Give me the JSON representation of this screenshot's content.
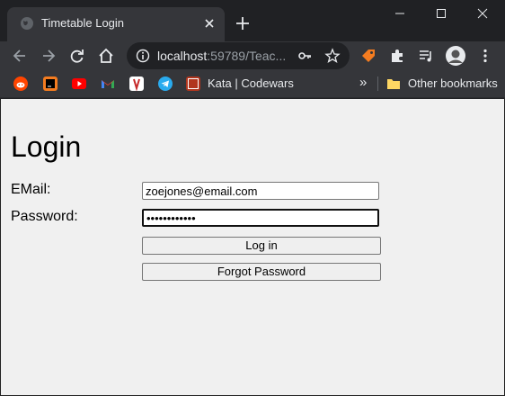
{
  "browser": {
    "tab": {
      "title": "Timetable Login"
    },
    "address": {
      "host": "localhost",
      "rest": ":59789/Teac..."
    },
    "bookmarks": [
      {
        "name": "reddit",
        "color": "#ff4500"
      },
      {
        "name": "jetbrains",
        "color": "#f47c20"
      },
      {
        "name": "youtube",
        "color": "#ff0000"
      },
      {
        "name": "gmail",
        "color": "#ea4335"
      },
      {
        "name": "bookmark-app",
        "color": "#e8eaed"
      },
      {
        "name": "telegram",
        "color": "#2aabee"
      }
    ],
    "codewars_label": "Kata | Codewars",
    "overflow": "»",
    "other_bookmarks": "Other bookmarks"
  },
  "page": {
    "title": "Login",
    "email": {
      "label": "EMail:",
      "value": "zoejones@email.com"
    },
    "password": {
      "label": "Password:",
      "value": "••••••••••••"
    },
    "login_button": "Log in",
    "forgot_button": "Forgot Password"
  }
}
